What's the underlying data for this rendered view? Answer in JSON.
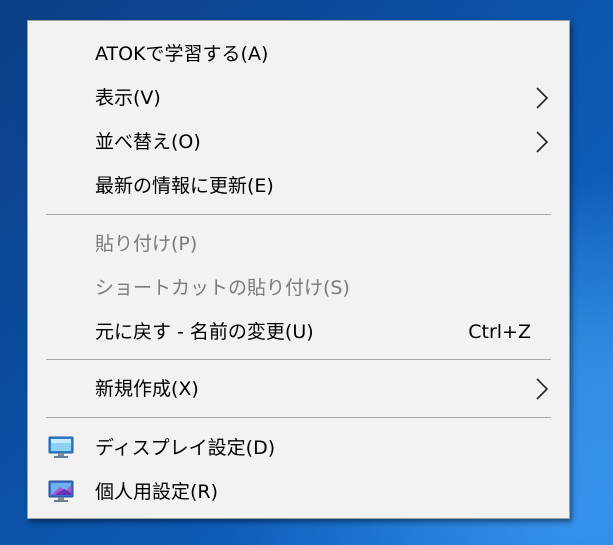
{
  "context_menu": {
    "items": [
      {
        "label": "ATOKで学習する(A)"
      },
      {
        "label": "表示(V)",
        "icon": "chevron-right-icon"
      },
      {
        "label": "並べ替え(O)",
        "icon": "chevron-right-icon"
      },
      {
        "label": "最新の情報に更新(E)"
      },
      {
        "label": "貼り付け(P)",
        "state": "disabled"
      },
      {
        "label": "ショートカットの貼り付け(S)",
        "state": "disabled"
      },
      {
        "label": "元に戻す - 名前の変更(U)",
        "shortcut": "Ctrl+Z"
      },
      {
        "label": "新規作成(X)",
        "icon": "chevron-right-icon"
      },
      {
        "label": "ディスプレイ設定(D)",
        "icon": "display-settings-icon"
      },
      {
        "label": "個人用設定(R)",
        "icon": "personalize-icon"
      }
    ]
  },
  "colors": {
    "menu_background": "#f2f2f2",
    "disabled_text": "#7a7a7a",
    "separator": "#a8a8a8",
    "desktop": "#0b4d9f"
  }
}
